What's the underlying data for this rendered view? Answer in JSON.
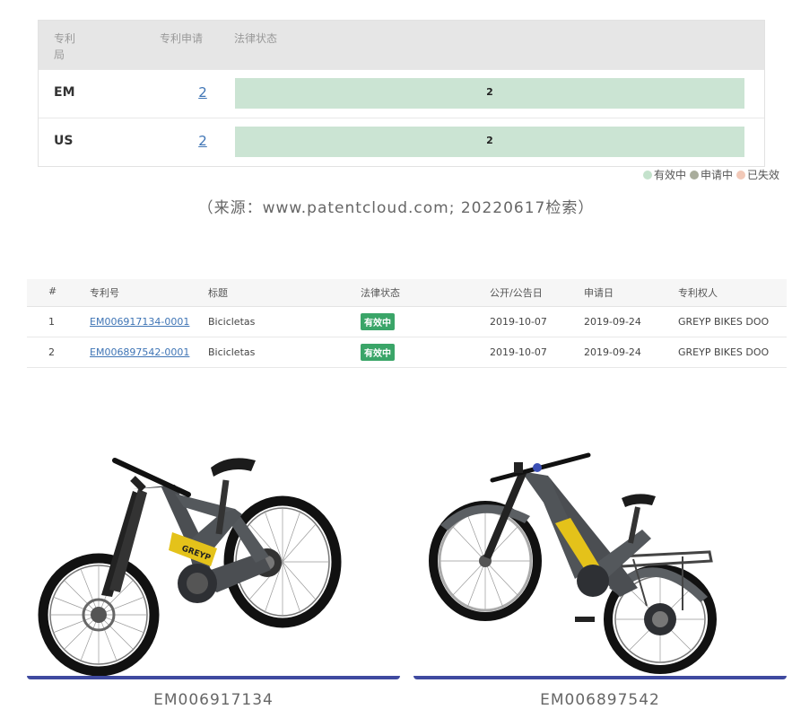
{
  "summary": {
    "headers": {
      "office": "专利局",
      "applications": "专利申请",
      "legal_status": "法律状态"
    },
    "rows": [
      {
        "office": "EM",
        "count": "2",
        "active": "2"
      },
      {
        "office": "US",
        "count": "2",
        "active": "2"
      }
    ],
    "legend": [
      {
        "label": "有效中",
        "color": "#c4e2cc"
      },
      {
        "label": "申请中",
        "color": "#a9ad9c"
      },
      {
        "label": "已失效",
        "color": "#f2c9b8"
      }
    ]
  },
  "source_note": "（来源：www.patentcloud.com; 20220617检索）",
  "details": {
    "headers": [
      "#",
      "专利号",
      "标题",
      "法律状态",
      "公开/公告日",
      "申请日",
      "专利权人"
    ],
    "rows": [
      {
        "index": "1",
        "number": "EM006917134-0001",
        "title": "Bicicletas",
        "status": "有效中",
        "pub_date": "2019-10-07",
        "app_date": "2019-09-24",
        "assignee": "GREYP BIKES DOO"
      },
      {
        "index": "2",
        "number": "EM006897542-0001",
        "title": "Bicicletas",
        "status": "有效中",
        "pub_date": "2019-10-07",
        "app_date": "2019-09-24",
        "assignee": "GREYP BIKES DOO"
      }
    ]
  },
  "images": [
    {
      "caption": "EM006917134",
      "accent": "#e4c21a"
    },
    {
      "caption": "EM006897542",
      "accent": "#e4c21a"
    }
  ]
}
